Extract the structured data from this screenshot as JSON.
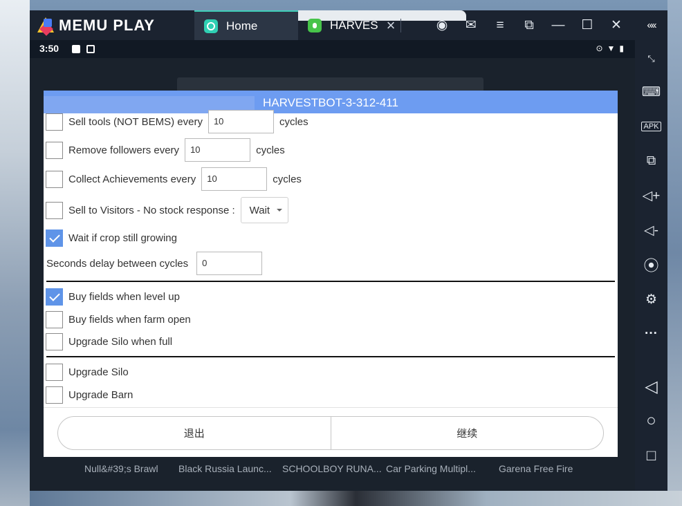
{
  "emulator": {
    "brand": "MEMU PLAY",
    "tabs": [
      {
        "label": "Home"
      },
      {
        "label": "HARVES"
      }
    ],
    "titlebar_icons": [
      "account-icon",
      "mail-icon",
      "menu-icon",
      "screen-icon",
      "minimize-icon",
      "maximize-icon",
      "close-icon"
    ],
    "collapse_label": "«‹‹",
    "sidebar_icons": [
      "fullscreen-icon",
      "keyboard-icon",
      "apk-icon",
      "multi-window-icon",
      "volume-up-icon",
      "volume-down-icon",
      "location-icon",
      "settings-icon",
      "more-icon",
      "back-icon",
      "home-icon",
      "recents-icon"
    ],
    "apk_label": "APK",
    "more_label": "···"
  },
  "statusbar": {
    "time": "3:50"
  },
  "bottom_apps": [
    "Null&#39;s Brawl",
    "Black Russia Launc...",
    "SCHOOLBOY RUNA...",
    "Car Parking Multipl...",
    "Garena Free Fire"
  ],
  "dialog": {
    "title": "HARVESTBOT-3-312-411",
    "rows": {
      "sell_tools": {
        "label": "Sell tools (NOT BEMS) every",
        "value": "10",
        "suffix": "cycles",
        "checked": false
      },
      "remove_followers": {
        "label": "Remove followers every",
        "value": "10",
        "suffix": "cycles",
        "checked": false
      },
      "collect_achievements": {
        "label": "Collect Achievements every",
        "value": "10",
        "suffix": "cycles",
        "checked": false
      },
      "sell_visitors": {
        "label": "Sell to Visitors - No stock response :",
        "select_value": "Wait",
        "checked": false
      },
      "wait_crop": {
        "label": "Wait if crop still growing",
        "checked": true
      },
      "seconds_delay": {
        "label": "Seconds delay between cycles",
        "value": "0"
      },
      "buy_fields_level": {
        "label": "Buy fields when level up",
        "checked": true
      },
      "buy_fields_farm": {
        "label": "Buy fields when farm open",
        "checked": false
      },
      "upgrade_silo_full": {
        "label": "Upgrade Silo when full",
        "checked": false
      },
      "upgrade_silo": {
        "label": "Upgrade Silo",
        "checked": false
      },
      "upgrade_barn": {
        "label": "Upgrade Barn",
        "checked": false
      }
    },
    "buttons": {
      "exit": "退出",
      "continue": "继续"
    }
  },
  "colors": {
    "accent": "#6d9cf1",
    "checkbox_checked": "#5f94e8",
    "window_bg": "#1b2330"
  }
}
